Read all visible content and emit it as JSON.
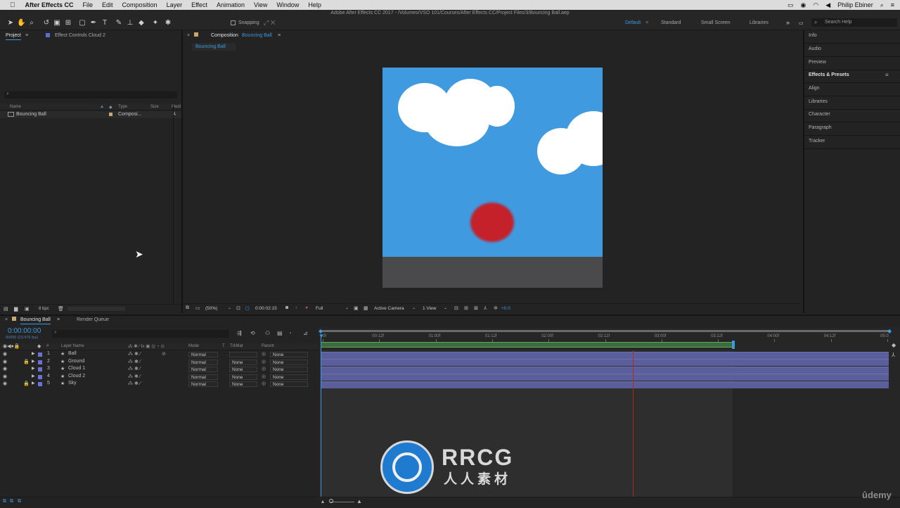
{
  "menubar": {
    "app_name": "After Effects CC",
    "items": [
      "File",
      "Edit",
      "Composition",
      "Layer",
      "Effect",
      "Animation",
      "View",
      "Window",
      "Help"
    ],
    "user": "Philip Ebiner"
  },
  "window_title": "Adobe After Effects CC 2017 - /Volumes/VSO 101/Courses/After Effects CC/Project Files/3/Bouncing Ball.aep",
  "toolbar": {
    "snapping_label": "Snapping",
    "workspaces": [
      "Default",
      "Standard",
      "Small Screen",
      "Libraries"
    ],
    "active_workspace": "Default",
    "search_placeholder": "Search Help"
  },
  "project_panel": {
    "tab_project": "Project",
    "tab_effect_controls": "Effect Controls Cloud 2",
    "columns": {
      "name": "Name",
      "type": "Type",
      "size": "Size",
      "media": "Medi"
    },
    "item": {
      "name": "Bouncing Ball",
      "type": "Composi..."
    },
    "bpc": "8 bpc"
  },
  "comp_panel": {
    "tab_prefix": "Composition",
    "tab_name": "Bouncing Ball",
    "subtab": "Bouncing Ball",
    "zoom": "(50%)",
    "timecode": "0:00:02:15",
    "resolution": "Full",
    "camera": "Active Camera",
    "view": "1 View",
    "exposure": "+0.0"
  },
  "right_panels": [
    "Info",
    "Audio",
    "Preview",
    "Effects & Presets",
    "Align",
    "Libraries",
    "Character",
    "Paragraph",
    "Tracker"
  ],
  "timeline": {
    "tab_name": "Bouncing Ball",
    "render_queue": "Render Queue",
    "timecode": "0:00:00:00",
    "timecode_sub": "00000 (23.976 fps)",
    "col_layer_name": "Layer Name",
    "col_mode": "Mode",
    "col_t": "T",
    "col_trkmat": "TrkMat",
    "col_parent": "Parent",
    "ruler_ticks": [
      "0f",
      "00:12f",
      "01:00f",
      "01:12f",
      "02:00f",
      "02:12f",
      "03:00f",
      "03:12f",
      "04:00f",
      "04:12f",
      "05:0"
    ],
    "layers": [
      {
        "num": "1",
        "name": "Ball",
        "mode": "Normal",
        "trkmat": "",
        "parent": "None"
      },
      {
        "num": "2",
        "name": "Ground",
        "mode": "Normal",
        "trkmat": "None",
        "parent": "None"
      },
      {
        "num": "3",
        "name": "Cloud 1",
        "mode": "Normal",
        "trkmat": "None",
        "parent": "None"
      },
      {
        "num": "4",
        "name": "Cloud 2",
        "mode": "Normal",
        "trkmat": "None",
        "parent": "None"
      },
      {
        "num": "5",
        "name": "Sky",
        "mode": "Normal",
        "trkmat": "None",
        "parent": "None"
      }
    ]
  },
  "watermark": {
    "brand": "RRCG",
    "sub": "人人素材",
    "udemy": "ûdemy"
  },
  "colors": {
    "accent": "#3b9ae1",
    "sky": "#3f9ae0",
    "ball": "#c4212a",
    "ground": "#4a4a4c",
    "layer_bar": "#5a5e9a"
  }
}
